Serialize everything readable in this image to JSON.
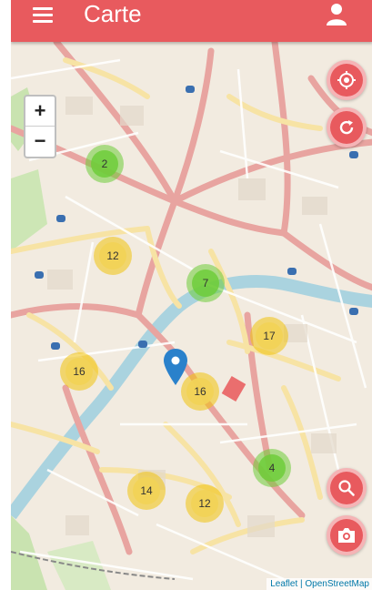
{
  "header": {
    "title": "Carte"
  },
  "map": {
    "zoom_in_label": "+",
    "zoom_out_label": "−",
    "attribution": "Leaflet | OpenStreetMap",
    "clusters": [
      {
        "count": "2",
        "color": "green"
      },
      {
        "count": "12",
        "color": "yellow"
      },
      {
        "count": "7",
        "color": "green"
      },
      {
        "count": "17",
        "color": "yellow"
      },
      {
        "count": "16",
        "color": "yellow"
      },
      {
        "count": "16",
        "color": "yellow"
      },
      {
        "count": "4",
        "color": "green"
      },
      {
        "count": "14",
        "color": "yellow"
      },
      {
        "count": "12",
        "color": "yellow"
      }
    ]
  },
  "colors": {
    "accent": "#e85a5e",
    "cluster_green": "#6ecc39",
    "cluster_yellow": "#f1d357",
    "marker_blue": "#2a81cb",
    "river": "#aad3df"
  },
  "icons": [
    "menu-icon",
    "user-icon",
    "locate-icon",
    "refresh-icon",
    "search-icon",
    "camera-icon",
    "map-pin-icon"
  ]
}
